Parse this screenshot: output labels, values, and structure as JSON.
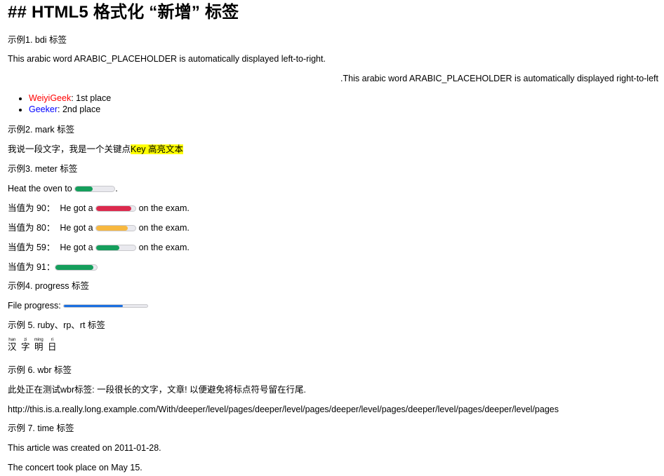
{
  "title": "## HTML5 格式化 “新增” 标签",
  "ex1": {
    "heading": "示例1. bdi 标签",
    "ltr_text": "This arabic word ARABIC_PLACEHOLDER is automatically displayed left-to-right.",
    "rtl_text": ".This arabic word ARABIC_PLACEHOLDER is automatically displayed right-to-left",
    "items": [
      {
        "name": "WeiyiGeek",
        "rest": ": 1st place",
        "color": "#ff0000"
      },
      {
        "name": "Geeker",
        "rest": ": 2nd place",
        "color": "#0000ff"
      }
    ]
  },
  "ex2": {
    "heading": "示例2. mark 标签",
    "text_before": "我说一段文字，我是一个关键点",
    "marked": "Key 高亮文本"
  },
  "ex3": {
    "heading": "示例3. meter 标签",
    "oven_prefix": "Heat the oven to",
    "oven_suffix": ".",
    "oven_value": 0.45,
    "rows": [
      {
        "prefix": "当值为 90：",
        "text": "He got a",
        "suffix": "on the exam.",
        "value": 0.9,
        "color": "#dc2a4d"
      },
      {
        "prefix": "当值为 80：",
        "text": "He got a",
        "suffix": "on the exam.",
        "value": 0.8,
        "color": "#f7b840"
      },
      {
        "prefix": "当值为 59：",
        "text": "He got a",
        "suffix": "on the exam.",
        "value": 0.59,
        "color": "#159f5c"
      }
    ],
    "last_prefix": "当值为 91：",
    "last_value": 0.91,
    "green": "#159f5c"
  },
  "ex4": {
    "heading": "示例4. progress 标签",
    "label": "File progress:",
    "value": 0.7,
    "color": "#1a6fe0"
  },
  "ex5": {
    "heading": "示例 5. ruby、rp、rt 标签",
    "chars": [
      {
        "base": "汉",
        "rt": "han"
      },
      {
        "base": "字",
        "rt": "zi"
      },
      {
        "base": "明",
        "rt": "ming"
      },
      {
        "base": "日",
        "rt": "ri"
      }
    ]
  },
  "ex6": {
    "heading": "示例 6. wbr 标签",
    "text": "此处正在测试wbr标签: 一段很长的文字，文章! 以便避免将标点符号留在行尾.",
    "url": "http://this.is.a.really.long.example.com/With/deeper/level/pages/deeper/level/pages/deeper/level/pages/deeper/level/pages/deeper/level/pages"
  },
  "ex7": {
    "heading": "示例 7. time 标签",
    "line1": "This article was created on 2011-01-28.",
    "line2": "The concert took place on May 15."
  }
}
